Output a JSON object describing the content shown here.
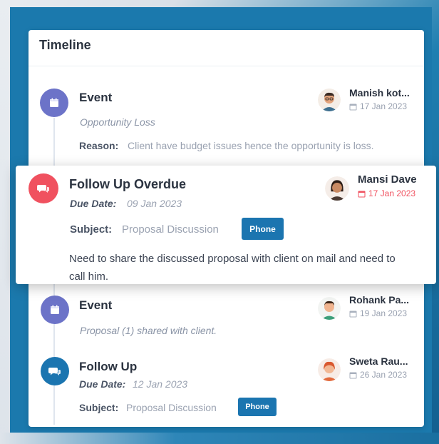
{
  "card": {
    "title": "Timeline"
  },
  "entries": [
    {
      "type": "event",
      "title": "Event",
      "detail": "Opportunity Loss",
      "reason_label": "Reason:",
      "reason_value": "Client have budget issues hence the opportunity is loss.",
      "person": {
        "name": "Manish kot...",
        "date": "17 Jan 2023"
      }
    },
    {
      "type": "follow-up-overdue",
      "title": "Follow Up Overdue",
      "due_label": "Due Date:",
      "due_value": "09 Jan 2023",
      "subject_label": "Subject:",
      "subject_value": "Proposal Discussion",
      "badge": "Phone",
      "note": "Need to share the discussed proposal with client on mail and need to call him.",
      "person": {
        "name": "Mansi Dave",
        "date": "17 Jan 2023"
      }
    },
    {
      "type": "event",
      "title": "Event",
      "detail": "Proposal (1) shared with client.",
      "person": {
        "name": "Rohank Pa...",
        "date": "19 Jan 2023"
      }
    },
    {
      "type": "follow-up",
      "title": "Follow Up",
      "due_label": "Due Date:",
      "due_value": "12 Jan 2023",
      "subject_label": "Subject:",
      "subject_value": "Proposal Discussion",
      "badge": "Phone",
      "person": {
        "name": "Sweta Rau...",
        "date": "26 Jan 2023"
      }
    }
  ],
  "icons": {
    "event": "calendar-icon",
    "follow_up": "chat-bubbles-icon",
    "date": "small-calendar-icon"
  },
  "colors": {
    "event_node": "#6c73c8",
    "follow_up_node": "#1b75b0",
    "overdue_node": "#f0515f",
    "overdue_date": "#f0515f",
    "badge": "#1b75b0"
  }
}
